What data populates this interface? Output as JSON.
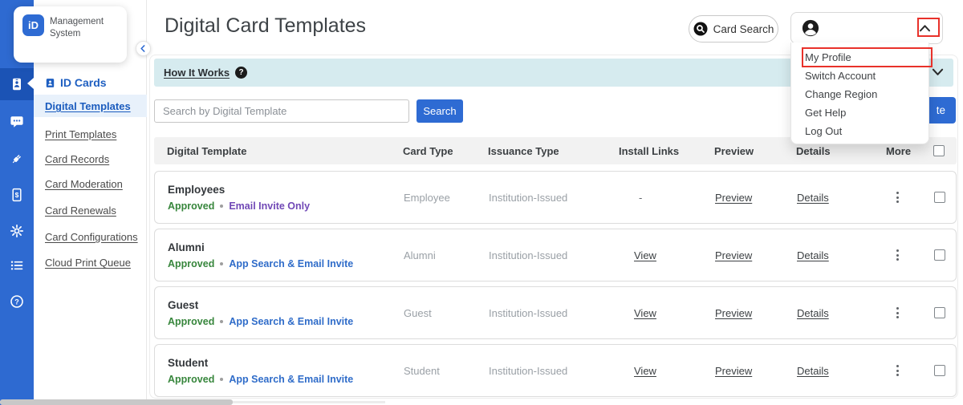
{
  "logo": {
    "abbr": "iD",
    "line1": "Management",
    "line2": "System"
  },
  "rail": {
    "icons": [
      "id-cards",
      "messages",
      "integrations-plug",
      "billing-document",
      "settings-gear",
      "list",
      "help"
    ]
  },
  "sidebar": {
    "section_label": "ID Cards",
    "items": [
      "Digital Templates",
      "Print Templates",
      "Card Records",
      "Card Moderation",
      "Card Renewals",
      "Card Configurations",
      "Cloud Print Queue"
    ],
    "active_item": "Digital Templates"
  },
  "page": {
    "title": "Digital Card Templates"
  },
  "top_actions": {
    "card_search_label": "Card Search"
  },
  "profile_menu": {
    "items": [
      "My Profile",
      "Switch Account",
      "Change Region",
      "Get Help",
      "Log Out"
    ]
  },
  "how_it_works": {
    "label": "How It Works"
  },
  "search": {
    "placeholder": "Search by Digital Template",
    "button_label": "Search"
  },
  "create_button": {
    "visible_text": "te"
  },
  "table": {
    "headers": [
      "Digital Template",
      "Card Type",
      "Issuance Type",
      "Install Links",
      "Preview",
      "Details",
      "More"
    ],
    "rows": [
      {
        "name": "Employees",
        "status": "Approved",
        "distribution": "Email Invite Only",
        "card_type": "Employee",
        "issuance_type": "Institution-Issued",
        "install_links": "-",
        "preview": "Preview",
        "details": "Details"
      },
      {
        "name": "Alumni",
        "status": "Approved",
        "distribution": "App Search & Email Invite",
        "card_type": "Alumni",
        "issuance_type": "Institution-Issued",
        "install_links": "View",
        "preview": "Preview",
        "details": "Details"
      },
      {
        "name": "Guest",
        "status": "Approved",
        "distribution": "App Search & Email Invite",
        "card_type": "Guest",
        "issuance_type": "Institution-Issued",
        "install_links": "View",
        "preview": "Preview",
        "details": "Details"
      },
      {
        "name": "Student",
        "status": "Approved",
        "distribution": "App Search & Email Invite",
        "card_type": "Student",
        "issuance_type": "Institution-Issued",
        "install_links": "View",
        "preview": "Preview",
        "details": "Details"
      }
    ]
  },
  "colors": {
    "rail_blue": "#2e6ad1",
    "rail_active_blue": "#1b53b5",
    "primary_blue": "#2e6bd3",
    "active_nav_blue": "#1e5fc1",
    "status_green": "#37863c",
    "distribution_purple": "#7048b6",
    "distribution_blue": "#2f6cc9",
    "hiw_teal": "#d6ebef",
    "annotation_red": "#e8312a"
  }
}
